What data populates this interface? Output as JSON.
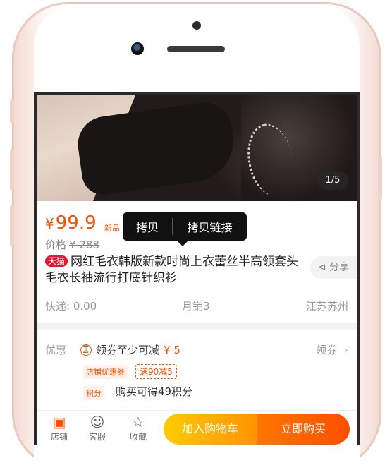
{
  "product": {
    "image_counter": "1/5",
    "price_symbol": "¥",
    "price": "99.9",
    "new_tag": "新品",
    "orig_label": "价格",
    "orig_price": "¥ 288",
    "tmall_badge": "天猫",
    "title": "网红毛衣韩版新款时尚上衣蕾丝半高领套头毛衣长袖流行打底针织衫",
    "share": "分享"
  },
  "tooltip": {
    "copy": "拷贝",
    "copy_link": "拷贝链接"
  },
  "meta": {
    "shipping": "快递: 0.00",
    "monthly_sales": "月销3",
    "location": "江苏苏州"
  },
  "promo": {
    "label": "优惠",
    "coupon_text": "领券至少可减",
    "coupon_amount": "¥ 5",
    "get_coupon": "领券",
    "store_tag": "店铺优惠券",
    "full_off": "满90减5",
    "points_tag": "积分",
    "points_text": "购买可得49积分"
  },
  "bottom_bar": {
    "shop": "店铺",
    "service": "客服",
    "favorite": "收藏",
    "add_to_cart": "加入购物车",
    "buy_now": "立即购买"
  },
  "colors": {
    "accent": "#ff5000",
    "cart": "#ff9402",
    "buy": "#ff4e00",
    "tmall": "#e8132f"
  }
}
